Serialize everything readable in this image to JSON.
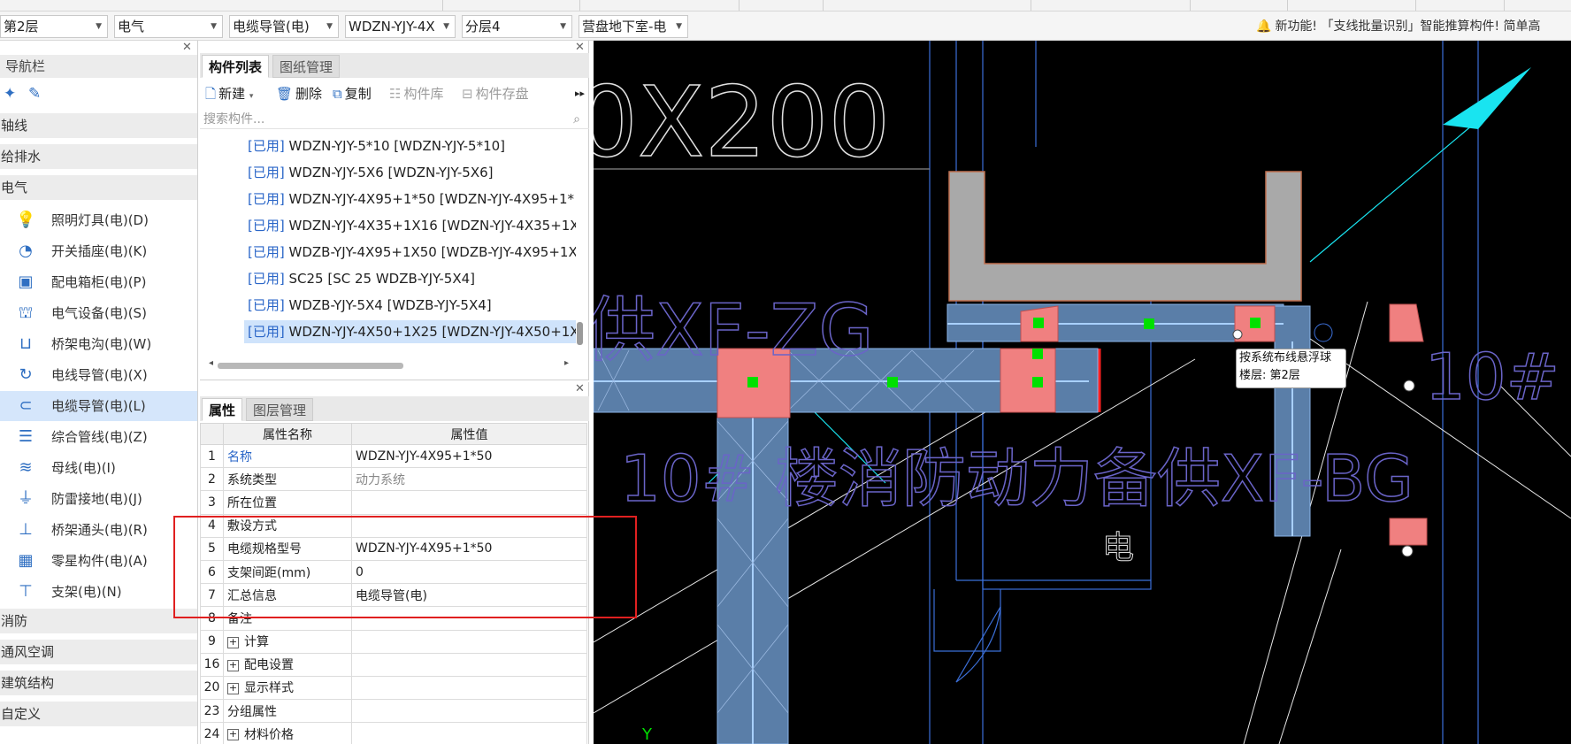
{
  "toolbar": {
    "floor": "第2层",
    "discipline": "电气",
    "component_type": "电缆导管(电)",
    "spec": "WDZN-YJY-4X",
    "layer": "分层4",
    "drawing": "营盘地下室-电",
    "notice": "新功能! 「支线批量识别」智能推算构件! 简单高"
  },
  "nav": {
    "title": "导航栏",
    "categories": {
      "axis": "轴线",
      "plumbing": "给排水",
      "electric": "电气",
      "fire": "消防",
      "hvac": "通风空调",
      "structure": "建筑结构",
      "custom": "自定义"
    },
    "items": [
      {
        "label": "照明灯具(电)(D)",
        "icon": "bulb-icon"
      },
      {
        "label": "开关插座(电)(K)",
        "icon": "switch-icon"
      },
      {
        "label": "配电箱柜(电)(P)",
        "icon": "panel-icon"
      },
      {
        "label": "电气设备(电)(S)",
        "icon": "device-icon"
      },
      {
        "label": "桥架电沟(电)(W)",
        "icon": "tray-icon"
      },
      {
        "label": "电线导管(电)(X)",
        "icon": "wire-icon"
      },
      {
        "label": "电缆导管(电)(L)",
        "icon": "cable-icon"
      },
      {
        "label": "综合管线(电)(Z)",
        "icon": "combined-icon"
      },
      {
        "label": "母线(电)(I)",
        "icon": "busbar-icon"
      },
      {
        "label": "防雷接地(电)(J)",
        "icon": "ground-icon"
      },
      {
        "label": "桥架通头(电)(R)",
        "icon": "tee-icon"
      },
      {
        "label": "零星构件(电)(A)",
        "icon": "grid-icon"
      },
      {
        "label": "支架(电)(N)",
        "icon": "bracket-icon"
      }
    ],
    "selected_index": 6
  },
  "components": {
    "tabs": [
      "构件列表",
      "图纸管理"
    ],
    "tools": {
      "new": "新建",
      "delete": "删除",
      "copy": "复制",
      "library": "构件库",
      "save": "构件存盘"
    },
    "search_placeholder": "搜索构件...",
    "used_tag": "[已用]",
    "rows": [
      "WDZN-YJY-5*10 [WDZN-YJY-5*10]",
      "WDZN-YJY-5X6 [WDZN-YJY-5X6]",
      "WDZN-YJY-4X95+1*50 [WDZN-YJY-4X95+1*",
      "WDZN-YJY-4X35+1X16 [WDZN-YJY-4X35+1X",
      "WDZB-YJY-4X95+1X50 [WDZB-YJY-4X95+1X",
      "SC25 [SC 25 WDZB-YJY-5X4]",
      "WDZB-YJY-5X4 [WDZB-YJY-5X4]",
      "WDZN-YJY-4X50+1X25 [WDZN-YJY-4X50+1X"
    ],
    "selected_index": 7
  },
  "properties": {
    "tabs": [
      "属性",
      "图层管理"
    ],
    "headers": {
      "name": "属性名称",
      "value": "属性值"
    },
    "rows": [
      {
        "no": "1",
        "name": "名称",
        "value": "WDZN-YJY-4X95+1*50"
      },
      {
        "no": "2",
        "name": "系统类型",
        "value": "动力系统"
      },
      {
        "no": "3",
        "name": "所在位置",
        "value": ""
      },
      {
        "no": "4",
        "name": "敷设方式",
        "value": ""
      },
      {
        "no": "5",
        "name": "电缆规格型号",
        "value": "WDZN-YJY-4X95+1*50"
      },
      {
        "no": "6",
        "name": "支架间距(mm)",
        "value": "0"
      },
      {
        "no": "7",
        "name": "汇总信息",
        "value": "电缆导管(电)"
      },
      {
        "no": "8",
        "name": "备注",
        "value": ""
      },
      {
        "no": "9",
        "name": "计算",
        "value": "",
        "group": true
      },
      {
        "no": "16",
        "name": "配电设置",
        "value": "",
        "group": true
      },
      {
        "no": "20",
        "name": "显示样式",
        "value": "",
        "group": true
      },
      {
        "no": "23",
        "name": "分组属性",
        "value": ""
      },
      {
        "no": "24",
        "name": "材料价格",
        "value": "",
        "group": true
      }
    ]
  },
  "canvas": {
    "tooltip_line1": "按系统布线悬浮球",
    "tooltip_line2": "楼层: 第2层",
    "text_top": "0X200",
    "text_mid": "供XF-ZG",
    "text_building": "10# 楼消防动力备供XF-BG",
    "text_elec": "电",
    "text_right": "10#",
    "axis_label": "Y",
    "colors": {
      "tray_fill": "#5a7ea8",
      "joint": "#f08080",
      "node": "#00e000",
      "beam": "#a9a9a9",
      "text_purple": "#6a64c8",
      "cyan": "#19e4f0"
    }
  }
}
